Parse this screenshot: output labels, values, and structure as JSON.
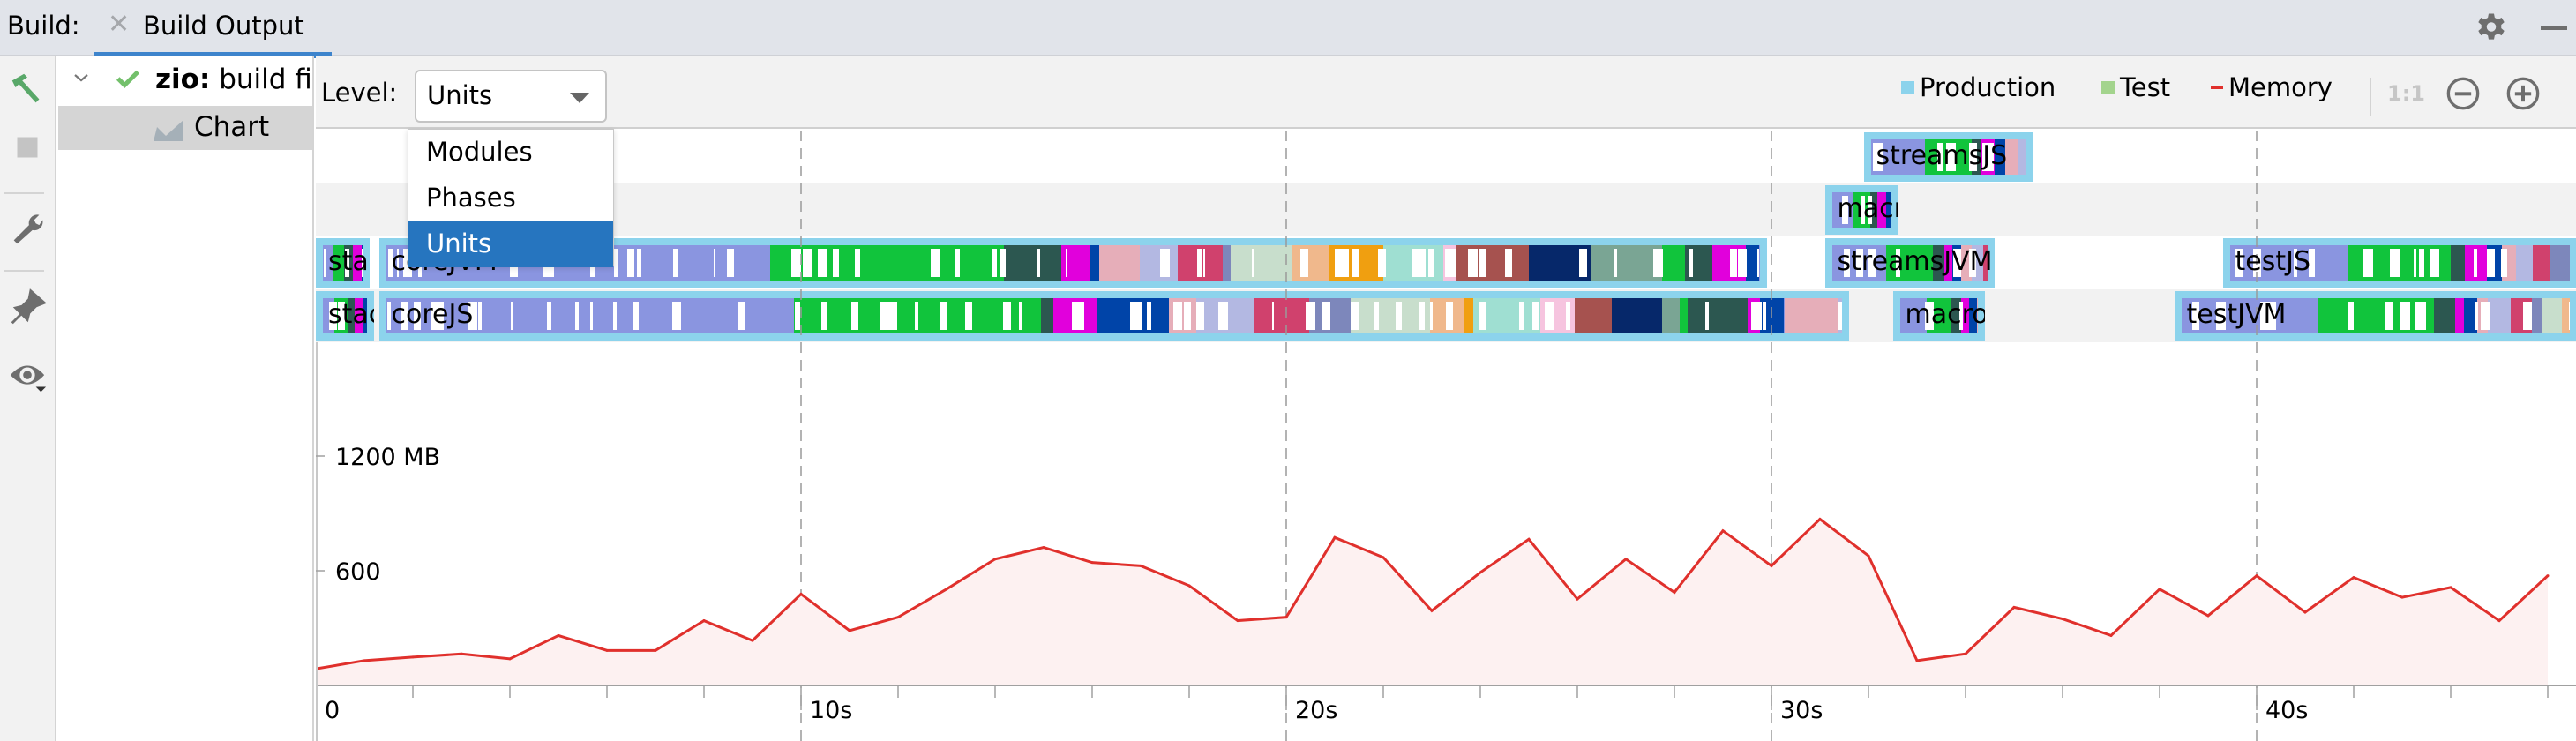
{
  "topbar": {
    "build_label": "Build:",
    "tab_label": "Build Output",
    "icons": {
      "close": "close-icon",
      "settings": "gear-icon",
      "minimize": "minimize-icon"
    }
  },
  "left_toolbar": {
    "items": [
      "hammer-icon",
      "stop-icon",
      "wrench-icon",
      "pin-icon",
      "eye-icon"
    ]
  },
  "tree": {
    "root": {
      "project": "zio:",
      "status": " build fi"
    },
    "child": {
      "label": "Chart"
    }
  },
  "header": {
    "level_label": "Level:",
    "level_value": "Units",
    "legend": [
      {
        "label": "Production",
        "color": "#8cd3ec"
      },
      {
        "label": "Test",
        "color": "#a3d48d"
      },
      {
        "label": "Memory",
        "color": "#e0302c"
      }
    ],
    "one_to_one": "1:1",
    "zoom_out": "zoom-out-icon",
    "zoom_in": "zoom-in-icon"
  },
  "dropdown": {
    "options": [
      "Modules",
      "Phases",
      "Units"
    ],
    "selected": "Units"
  },
  "gantt": {
    "time_unit": "s",
    "bars": [
      {
        "lane": 0,
        "label": "streamsJS",
        "start": 31.9,
        "end": 35.4,
        "kind": "Production"
      },
      {
        "lane": 1,
        "label": "macrosJVM",
        "start": 31.1,
        "end": 32.6,
        "kind": "Production"
      },
      {
        "lane": 2,
        "label": "stack...",
        "start": 0.0,
        "end": 1.1,
        "kind": "Production"
      },
      {
        "lane": 2,
        "label": "coreJVM",
        "start": 1.3,
        "end": 29.9,
        "kind": "Production"
      },
      {
        "lane": 2,
        "label": "streamsJVM",
        "start": 31.1,
        "end": 34.6,
        "kind": "Production"
      },
      {
        "lane": 2,
        "label": "testJS",
        "start": 39.3,
        "end": 46.6,
        "kind": "Production"
      },
      {
        "lane": 3,
        "label": "stac...",
        "start": 0.0,
        "end": 1.2,
        "kind": "Production"
      },
      {
        "lane": 3,
        "label": "coreJS",
        "start": 1.3,
        "end": 31.6,
        "kind": "Production"
      },
      {
        "lane": 3,
        "label": "macrosJS",
        "start": 32.5,
        "end": 34.4,
        "kind": "Production"
      },
      {
        "lane": 3,
        "label": "testJVM",
        "start": 38.3,
        "end": 46.6,
        "kind": "Production"
      }
    ]
  },
  "chart_data": {
    "type": "area",
    "title": "",
    "xlabel": "",
    "ylabel": "",
    "series": [
      {
        "name": "Memory",
        "color": "#e0302c",
        "x": [
          0,
          1,
          2,
          3,
          4,
          5,
          6,
          7,
          8,
          9,
          10,
          11,
          12,
          13,
          14,
          15,
          16,
          17,
          18,
          19,
          20,
          21,
          22,
          23,
          24,
          25,
          26,
          27,
          28,
          29,
          30,
          31,
          32,
          33,
          34,
          35,
          36,
          37,
          38,
          39,
          40,
          41,
          42,
          43,
          44,
          45,
          46
        ],
        "values": [
          87,
          130,
          148,
          165,
          139,
          261,
          183,
          183,
          339,
          235,
          478,
          287,
          357,
          504,
          661,
          722,
          643,
          626,
          522,
          339,
          357,
          774,
          670,
          391,
          591,
          765,
          452,
          661,
          487,
          809,
          626,
          870,
          678,
          130,
          165,
          409,
          348,
          261,
          504,
          365,
          574,
          383,
          565,
          461,
          513,
          339,
          574
        ]
      }
    ],
    "x_ticks": [
      "0",
      "10s",
      "20s",
      "30s",
      "40s"
    ],
    "x_tick_values": [
      0,
      10,
      20,
      30,
      40
    ],
    "y_ticks": [
      "600",
      "1200 MB"
    ],
    "y_tick_values": [
      600,
      1200
    ],
    "xlim": [
      0,
      46.6
    ],
    "ylim": [
      0,
      1200
    ],
    "grid": "vertical-dashed",
    "legend": "top-right"
  }
}
